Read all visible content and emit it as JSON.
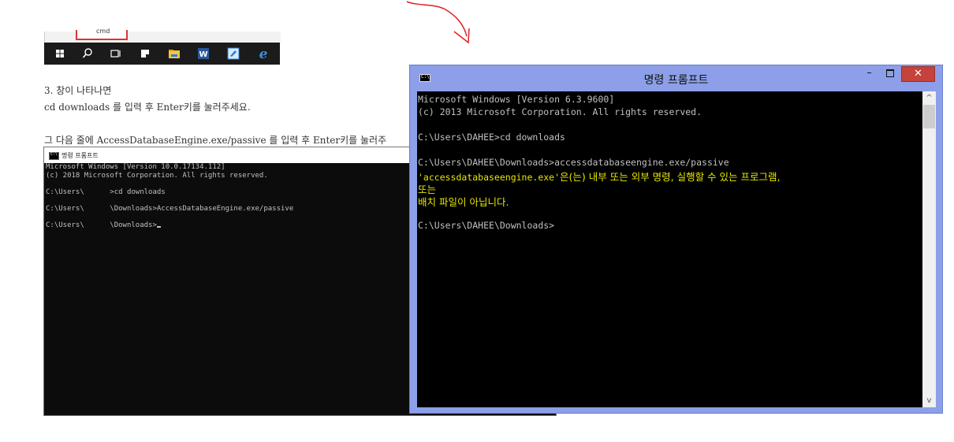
{
  "taskbar_snippet": {
    "context_text": "cmd",
    "icons": [
      "windows-start-icon",
      "search-icon",
      "task-view-icon",
      "sticky-notes-icon",
      "file-explorer-icon",
      "word-icon",
      "paint-icon",
      "edge-icon"
    ]
  },
  "document": {
    "step3_line": "3. 창이 나타나면",
    "line2": "cd downloads 를 입력 후 Enter키를 눌러주세요.",
    "line3": "그 다음 줄에 AccessDatabaseEngine.exe/passive 를 입력 후 Enter키를 눌러주"
  },
  "old_console": {
    "title": "명령 프롬프트",
    "lines": [
      "Microsoft Windows [Version 10.0.17134.112]",
      "(c) 2018 Microsoft Corporation. All rights reserved.",
      "",
      "C:\\Users\\      >cd downloads",
      "",
      "C:\\Users\\      \\Downloads>AccessDatabaseEngine.exe/passive",
      "",
      "C:\\Users\\      \\Downloads>"
    ]
  },
  "main_console": {
    "title": "명령 프롬프트",
    "minimize_label": "–",
    "close_label": "✕",
    "lines": {
      "l1": "Microsoft Windows [Version 6.3.9600]",
      "l2": "(c) 2013 Microsoft Corporation. All rights reserved.",
      "l3": "C:\\Users\\DAHEE>cd downloads",
      "l4": "C:\\Users\\DAHEE\\Downloads>accessdatabaseengine.exe/passive",
      "l5a": "'accessdatabaseengine.exe'",
      "l5b": "은(는) 내부 또는 외부 명령, 실행할 수 있는 프로그램,",
      "l6": "또는",
      "l7": "배치 파일이 아닙니다.",
      "l8": "C:\\Users\\DAHEE\\Downloads>"
    }
  },
  "colors": {
    "title_bar": "#8c9fe8",
    "close_button": "#c6423c",
    "console_bg": "#000000",
    "console_text": "#c0c0c0",
    "highlight_text": "#e6e600",
    "annotation_arrow": "#e02020"
  }
}
